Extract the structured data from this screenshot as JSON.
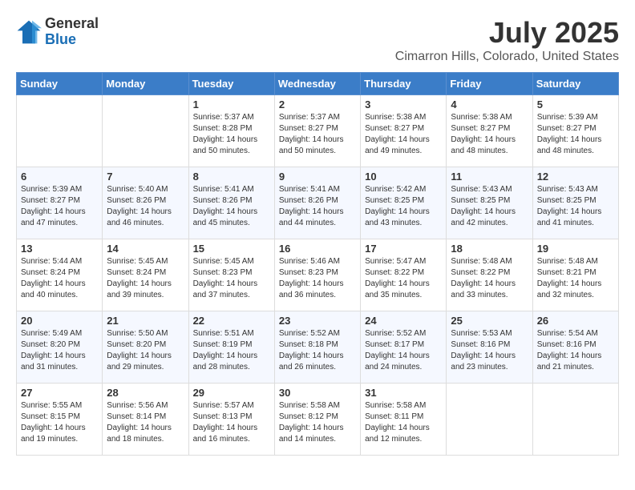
{
  "logo": {
    "general": "General",
    "blue": "Blue"
  },
  "title": "July 2025",
  "location": "Cimarron Hills, Colorado, United States",
  "weekdays": [
    "Sunday",
    "Monday",
    "Tuesday",
    "Wednesday",
    "Thursday",
    "Friday",
    "Saturday"
  ],
  "weeks": [
    [
      {
        "day": "",
        "sunrise": "",
        "sunset": "",
        "daylight": ""
      },
      {
        "day": "",
        "sunrise": "",
        "sunset": "",
        "daylight": ""
      },
      {
        "day": "1",
        "sunrise": "Sunrise: 5:37 AM",
        "sunset": "Sunset: 8:28 PM",
        "daylight": "Daylight: 14 hours and 50 minutes."
      },
      {
        "day": "2",
        "sunrise": "Sunrise: 5:37 AM",
        "sunset": "Sunset: 8:27 PM",
        "daylight": "Daylight: 14 hours and 50 minutes."
      },
      {
        "day": "3",
        "sunrise": "Sunrise: 5:38 AM",
        "sunset": "Sunset: 8:27 PM",
        "daylight": "Daylight: 14 hours and 49 minutes."
      },
      {
        "day": "4",
        "sunrise": "Sunrise: 5:38 AM",
        "sunset": "Sunset: 8:27 PM",
        "daylight": "Daylight: 14 hours and 48 minutes."
      },
      {
        "day": "5",
        "sunrise": "Sunrise: 5:39 AM",
        "sunset": "Sunset: 8:27 PM",
        "daylight": "Daylight: 14 hours and 48 minutes."
      }
    ],
    [
      {
        "day": "6",
        "sunrise": "Sunrise: 5:39 AM",
        "sunset": "Sunset: 8:27 PM",
        "daylight": "Daylight: 14 hours and 47 minutes."
      },
      {
        "day": "7",
        "sunrise": "Sunrise: 5:40 AM",
        "sunset": "Sunset: 8:26 PM",
        "daylight": "Daylight: 14 hours and 46 minutes."
      },
      {
        "day": "8",
        "sunrise": "Sunrise: 5:41 AM",
        "sunset": "Sunset: 8:26 PM",
        "daylight": "Daylight: 14 hours and 45 minutes."
      },
      {
        "day": "9",
        "sunrise": "Sunrise: 5:41 AM",
        "sunset": "Sunset: 8:26 PM",
        "daylight": "Daylight: 14 hours and 44 minutes."
      },
      {
        "day": "10",
        "sunrise": "Sunrise: 5:42 AM",
        "sunset": "Sunset: 8:25 PM",
        "daylight": "Daylight: 14 hours and 43 minutes."
      },
      {
        "day": "11",
        "sunrise": "Sunrise: 5:43 AM",
        "sunset": "Sunset: 8:25 PM",
        "daylight": "Daylight: 14 hours and 42 minutes."
      },
      {
        "day": "12",
        "sunrise": "Sunrise: 5:43 AM",
        "sunset": "Sunset: 8:25 PM",
        "daylight": "Daylight: 14 hours and 41 minutes."
      }
    ],
    [
      {
        "day": "13",
        "sunrise": "Sunrise: 5:44 AM",
        "sunset": "Sunset: 8:24 PM",
        "daylight": "Daylight: 14 hours and 40 minutes."
      },
      {
        "day": "14",
        "sunrise": "Sunrise: 5:45 AM",
        "sunset": "Sunset: 8:24 PM",
        "daylight": "Daylight: 14 hours and 39 minutes."
      },
      {
        "day": "15",
        "sunrise": "Sunrise: 5:45 AM",
        "sunset": "Sunset: 8:23 PM",
        "daylight": "Daylight: 14 hours and 37 minutes."
      },
      {
        "day": "16",
        "sunrise": "Sunrise: 5:46 AM",
        "sunset": "Sunset: 8:23 PM",
        "daylight": "Daylight: 14 hours and 36 minutes."
      },
      {
        "day": "17",
        "sunrise": "Sunrise: 5:47 AM",
        "sunset": "Sunset: 8:22 PM",
        "daylight": "Daylight: 14 hours and 35 minutes."
      },
      {
        "day": "18",
        "sunrise": "Sunrise: 5:48 AM",
        "sunset": "Sunset: 8:22 PM",
        "daylight": "Daylight: 14 hours and 33 minutes."
      },
      {
        "day": "19",
        "sunrise": "Sunrise: 5:48 AM",
        "sunset": "Sunset: 8:21 PM",
        "daylight": "Daylight: 14 hours and 32 minutes."
      }
    ],
    [
      {
        "day": "20",
        "sunrise": "Sunrise: 5:49 AM",
        "sunset": "Sunset: 8:20 PM",
        "daylight": "Daylight: 14 hours and 31 minutes."
      },
      {
        "day": "21",
        "sunrise": "Sunrise: 5:50 AM",
        "sunset": "Sunset: 8:20 PM",
        "daylight": "Daylight: 14 hours and 29 minutes."
      },
      {
        "day": "22",
        "sunrise": "Sunrise: 5:51 AM",
        "sunset": "Sunset: 8:19 PM",
        "daylight": "Daylight: 14 hours and 28 minutes."
      },
      {
        "day": "23",
        "sunrise": "Sunrise: 5:52 AM",
        "sunset": "Sunset: 8:18 PM",
        "daylight": "Daylight: 14 hours and 26 minutes."
      },
      {
        "day": "24",
        "sunrise": "Sunrise: 5:52 AM",
        "sunset": "Sunset: 8:17 PM",
        "daylight": "Daylight: 14 hours and 24 minutes."
      },
      {
        "day": "25",
        "sunrise": "Sunrise: 5:53 AM",
        "sunset": "Sunset: 8:16 PM",
        "daylight": "Daylight: 14 hours and 23 minutes."
      },
      {
        "day": "26",
        "sunrise": "Sunrise: 5:54 AM",
        "sunset": "Sunset: 8:16 PM",
        "daylight": "Daylight: 14 hours and 21 minutes."
      }
    ],
    [
      {
        "day": "27",
        "sunrise": "Sunrise: 5:55 AM",
        "sunset": "Sunset: 8:15 PM",
        "daylight": "Daylight: 14 hours and 19 minutes."
      },
      {
        "day": "28",
        "sunrise": "Sunrise: 5:56 AM",
        "sunset": "Sunset: 8:14 PM",
        "daylight": "Daylight: 14 hours and 18 minutes."
      },
      {
        "day": "29",
        "sunrise": "Sunrise: 5:57 AM",
        "sunset": "Sunset: 8:13 PM",
        "daylight": "Daylight: 14 hours and 16 minutes."
      },
      {
        "day": "30",
        "sunrise": "Sunrise: 5:58 AM",
        "sunset": "Sunset: 8:12 PM",
        "daylight": "Daylight: 14 hours and 14 minutes."
      },
      {
        "day": "31",
        "sunrise": "Sunrise: 5:58 AM",
        "sunset": "Sunset: 8:11 PM",
        "daylight": "Daylight: 14 hours and 12 minutes."
      },
      {
        "day": "",
        "sunrise": "",
        "sunset": "",
        "daylight": ""
      },
      {
        "day": "",
        "sunrise": "",
        "sunset": "",
        "daylight": ""
      }
    ]
  ]
}
